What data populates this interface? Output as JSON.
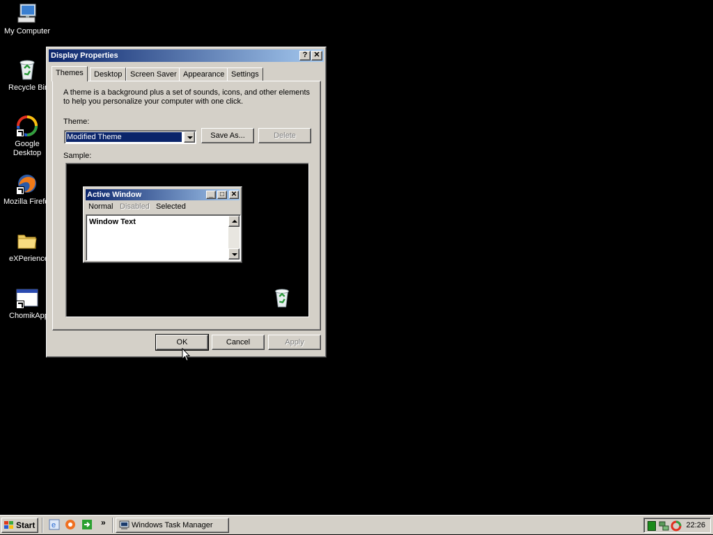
{
  "desktop": {
    "icons": [
      {
        "name": "my-computer",
        "label": "My Computer"
      },
      {
        "name": "recycle-bin",
        "label": "Recycle Bin"
      },
      {
        "name": "google-desktop",
        "label": "Google Desktop"
      },
      {
        "name": "mozilla-firefox",
        "label": "Mozilla Firefox"
      },
      {
        "name": "experience",
        "label": "eXPerience"
      },
      {
        "name": "chomikapp",
        "label": "ChomikApp"
      }
    ],
    "background": "#000000"
  },
  "dialog": {
    "title": "Display Properties",
    "help_glyph": "?",
    "close_glyph": "✕",
    "tabs": [
      {
        "label": "Themes",
        "active": true
      },
      {
        "label": "Desktop"
      },
      {
        "label": "Screen Saver"
      },
      {
        "label": "Appearance"
      },
      {
        "label": "Settings"
      }
    ],
    "description_line1": "A theme is a background plus a set of sounds, icons, and other elements",
    "description_line2": "to help you personalize your computer with one click.",
    "theme_label": "Theme:",
    "theme_value": "Modified Theme",
    "save_as_label": "Save As...",
    "delete_label": "Delete",
    "sample_label": "Sample:",
    "sample": {
      "window_title": "Active Window",
      "menu_normal": "Normal",
      "menu_disabled": "Disabled",
      "menu_selected": "Selected",
      "window_text": "Window Text"
    },
    "ok_label": "OK",
    "cancel_label": "Cancel",
    "apply_label": "Apply"
  },
  "taskbar": {
    "start_label": "Start",
    "more_glyph": "»",
    "task_label": "Windows Task Manager",
    "clock": "22:26"
  },
  "colors": {
    "title_active_start": "#0a246a",
    "title_active_end": "#a6caf0",
    "face": "#d4d0c8",
    "selection": "#0a246a"
  }
}
